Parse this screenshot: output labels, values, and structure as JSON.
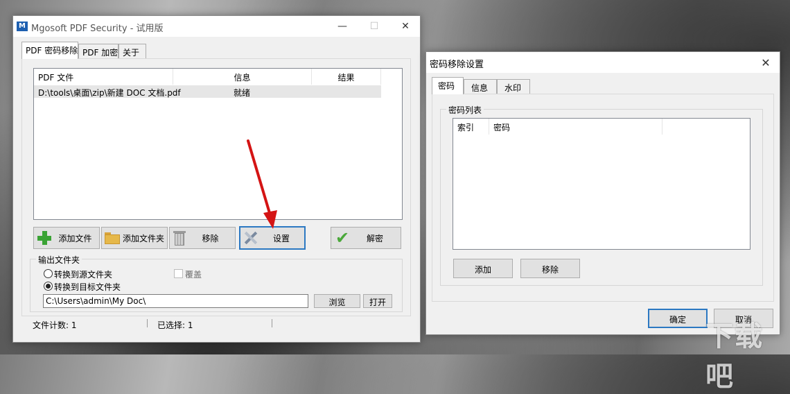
{
  "main_window": {
    "title": "Mgosoft PDF Security - 试用版",
    "tabs": [
      "PDF 密码移除",
      "PDF 加密",
      "关于"
    ],
    "file_list": {
      "columns": [
        "PDF 文件",
        "信息",
        "结果"
      ],
      "rows": [
        {
          "file": "D:\\tools\\桌面\\zip\\新建 DOC 文档.pdf",
          "info": "就绪",
          "result": ""
        }
      ]
    },
    "buttons": {
      "add_file": "添加文件",
      "add_folder": "添加文件夹",
      "remove": "移除",
      "settings": "设置",
      "decrypt": "解密"
    },
    "output": {
      "legend": "输出文件夹",
      "option_source": "转换到源文件夹",
      "option_target": "转换到目标文件夹",
      "overwrite": "覆盖",
      "selected_option": "target",
      "path": "C:\\Users\\admin\\My Doc\\",
      "browse": "浏览",
      "open": "打开"
    },
    "status": {
      "file_count": "文件计数: 1",
      "selected": "已选择: 1"
    }
  },
  "dialog": {
    "title": "密码移除设置",
    "tabs": [
      "密码",
      "信息",
      "水印"
    ],
    "group_label": "密码列表",
    "columns": [
      "索引",
      "密码"
    ],
    "add": "添加",
    "remove": "移除",
    "ok": "确定",
    "cancel": "取消"
  },
  "watermark": "下载吧",
  "colors": {
    "focus_border": "#2b78c2",
    "arrow": "#d41414",
    "plus_icon": "#3aa335",
    "check_icon": "#4aa83a",
    "folder_icon": "#e6b84a"
  }
}
